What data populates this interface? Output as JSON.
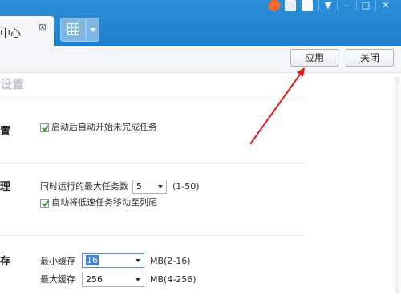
{
  "tab": {
    "label": "中心",
    "close": "⊠"
  },
  "window_controls": {
    "minimize": "–",
    "maximize": "□",
    "close": "✕",
    "menu": "▼"
  },
  "toolbar": {
    "apply_label": "应用",
    "close_label": "关闭"
  },
  "section_title": "设置",
  "sections": [
    {
      "label": "置",
      "rows": [
        {
          "checkbox": true,
          "text": "启动后自动开始未完成任务"
        }
      ]
    },
    {
      "label": "理",
      "max_tasks_label": "同时运行的最大任务数",
      "max_tasks_value": "5",
      "max_tasks_range": "(1-50)",
      "move_slow_label": "自动将低速任务移动至列尾"
    },
    {
      "label": "存",
      "min_cache_label": "最小缓存",
      "min_cache_value": "16",
      "min_cache_range": "MB(2-16)",
      "max_cache_label": "最大缓存",
      "max_cache_value": "256",
      "max_cache_range": "MB(4-256)"
    }
  ],
  "colors": {
    "titlebar": "#1f7fcc",
    "arrow": "#e21b1b"
  }
}
